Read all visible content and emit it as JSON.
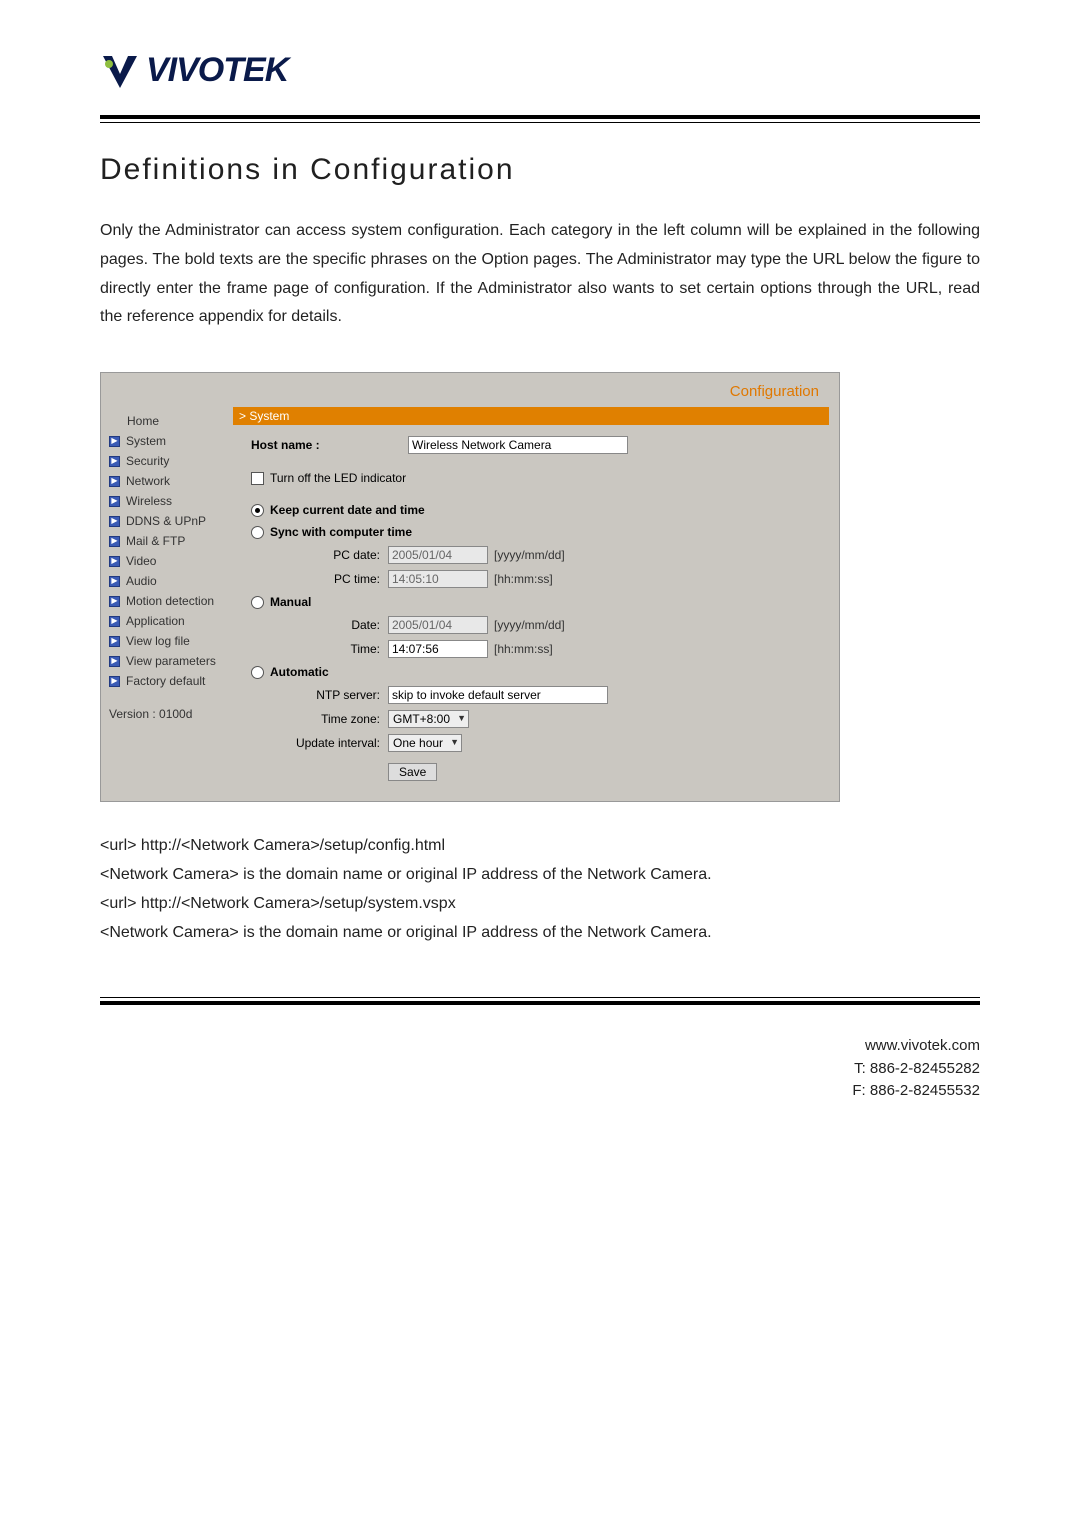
{
  "brand": {
    "name": "VIVOTEK"
  },
  "doc": {
    "title": "Definitions in Configuration",
    "intro": "Only the Administrator can access system configuration. Each category in the left column will be explained in the following pages. The bold texts are the specific phrases on the Option pages. The Administrator may type the URL below the figure to directly enter the frame page of configuration. If the Administrator also wants to set certain options through the URL, read the reference appendix for details."
  },
  "config": {
    "header_label": "Configuration",
    "sidebar": {
      "items": [
        {
          "label": "Home",
          "icon": false
        },
        {
          "label": "System",
          "icon": true
        },
        {
          "label": "Security",
          "icon": true
        },
        {
          "label": "Network",
          "icon": true
        },
        {
          "label": "Wireless",
          "icon": true
        },
        {
          "label": "DDNS & UPnP",
          "icon": true
        },
        {
          "label": "Mail & FTP",
          "icon": true
        },
        {
          "label": "Video",
          "icon": true
        },
        {
          "label": "Audio",
          "icon": true
        },
        {
          "label": "Motion detection",
          "icon": true
        },
        {
          "label": "Application",
          "icon": true
        },
        {
          "label": "View log file",
          "icon": true
        },
        {
          "label": "View parameters",
          "icon": true
        },
        {
          "label": "Factory default",
          "icon": true
        }
      ],
      "version": "Version : 0100d"
    },
    "section_title": "> System",
    "hostname_label": "Host name :",
    "hostname_value": "Wireless Network Camera",
    "led_label": "Turn off the LED indicator",
    "time": {
      "keep_label": "Keep current date and time",
      "sync_label": "Sync with computer time",
      "pc_date_label": "PC date:",
      "pc_date_value": "2005/01/04",
      "pc_date_hint": "[yyyy/mm/dd]",
      "pc_time_label": "PC time:",
      "pc_time_value": "14:05:10",
      "pc_time_hint": "[hh:mm:ss]",
      "manual_label": "Manual",
      "manual_date_label": "Date:",
      "manual_date_value": "2005/01/04",
      "manual_date_hint": "[yyyy/mm/dd]",
      "manual_time_label": "Time:",
      "manual_time_value": "14:07:56",
      "manual_time_hint": "[hh:mm:ss]",
      "auto_label": "Automatic",
      "ntp_label": "NTP server:",
      "ntp_value": "skip to invoke default server",
      "tz_label": "Time zone:",
      "tz_value": "GMT+8:00",
      "interval_label": "Update interval:",
      "interval_value": "One hour"
    },
    "save_label": "Save"
  },
  "urls": {
    "l1": "<url> http://<Network Camera>/setup/config.html",
    "l2": "<Network Camera> is the domain name or original IP address of the Network Camera.",
    "l3": "<url> http://<Network Camera>/setup/system.vspx",
    "l4": "<Network Camera> is the domain name or original IP address of the Network Camera."
  },
  "footer": {
    "website": "www.vivotek.com",
    "tel": "T: 886-2-82455282",
    "fax": "F: 886-2-82455532"
  }
}
